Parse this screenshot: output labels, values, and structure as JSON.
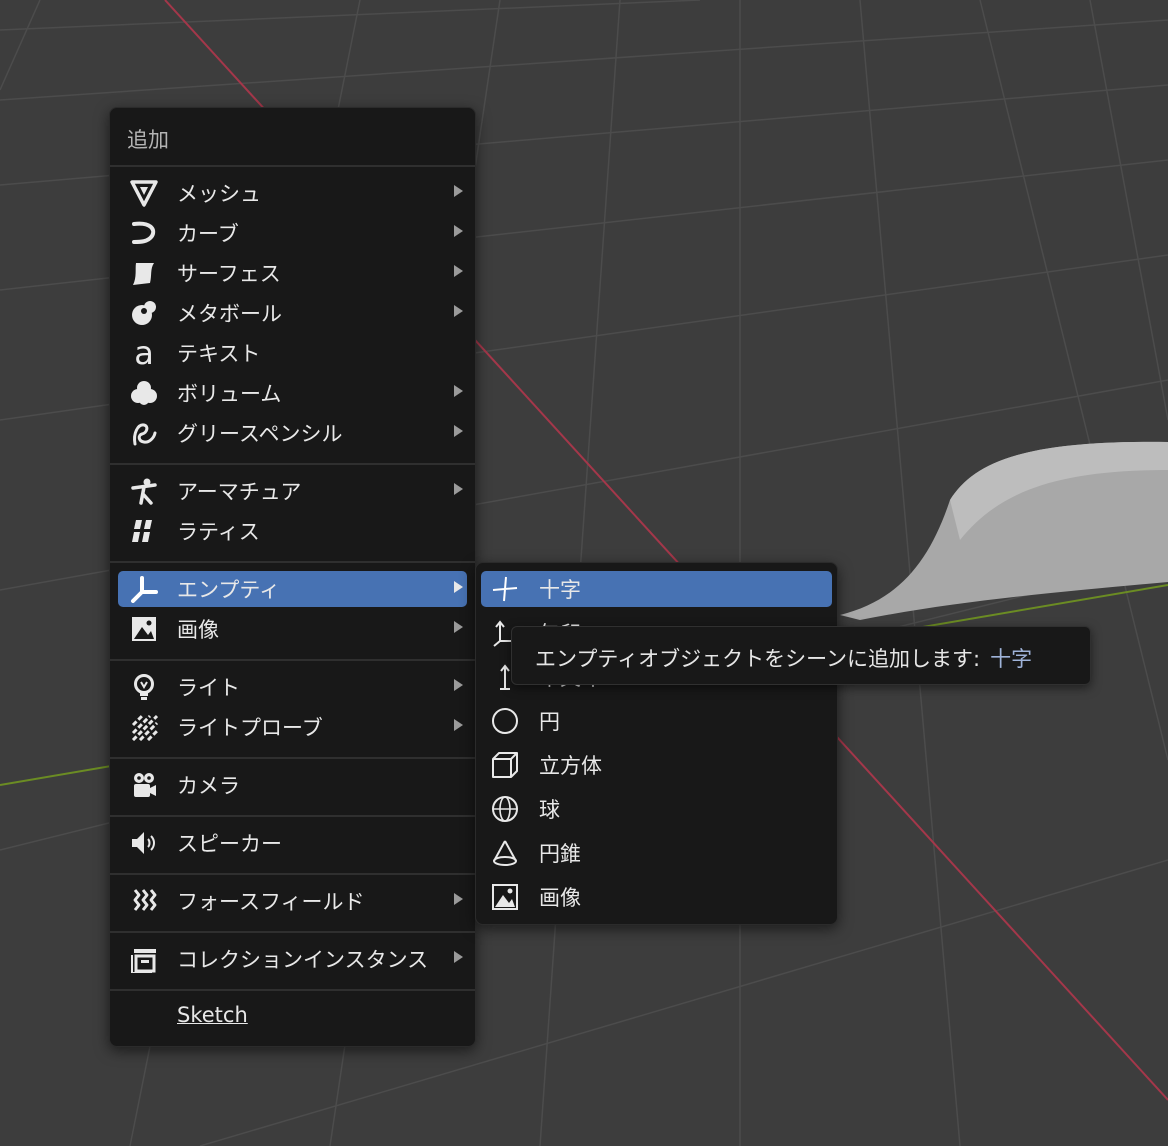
{
  "add_menu": {
    "title": "追加",
    "items": [
      {
        "label": "メッシュ",
        "icon": "mesh-icon",
        "submenu": true
      },
      {
        "label": "カーブ",
        "icon": "curve-icon",
        "submenu": true
      },
      {
        "label": "サーフェス",
        "icon": "surface-icon",
        "submenu": true
      },
      {
        "label": "メタボール",
        "icon": "metaball-icon",
        "submenu": true
      },
      {
        "label": "テキスト",
        "icon": "text-icon",
        "submenu": false
      },
      {
        "label": "ボリューム",
        "icon": "volume-icon",
        "submenu": true
      },
      {
        "label": "グリースペンシル",
        "icon": "grease-pencil-icon",
        "submenu": true
      },
      {
        "label": "アーマチュア",
        "icon": "armature-icon",
        "submenu": true
      },
      {
        "label": "ラティス",
        "icon": "lattice-icon",
        "submenu": false
      },
      {
        "label": "エンプティ",
        "icon": "empty-icon",
        "submenu": true,
        "highlighted": true
      },
      {
        "label": "画像",
        "icon": "image-icon",
        "submenu": true
      },
      {
        "label": "ライト",
        "icon": "light-icon",
        "submenu": true
      },
      {
        "label": "ライトプローブ",
        "icon": "light-probe-icon",
        "submenu": true
      },
      {
        "label": "カメラ",
        "icon": "camera-icon",
        "submenu": false
      },
      {
        "label": "スピーカー",
        "icon": "speaker-icon",
        "submenu": false
      },
      {
        "label": "フォースフィールド",
        "icon": "force-field-icon",
        "submenu": true
      },
      {
        "label": "コレクションインスタンス",
        "icon": "collection-instance-icon",
        "submenu": true
      },
      {
        "label": "Sketch",
        "icon": "",
        "submenu": false
      }
    ]
  },
  "empty_menu": {
    "items": [
      {
        "label": "十字",
        "icon": "plain-axes-icon",
        "highlighted": true
      },
      {
        "label": "矢印",
        "icon": "arrows-icon"
      },
      {
        "label": "単矢印",
        "icon": "single-arrow-icon"
      },
      {
        "label": "円",
        "icon": "circle-icon"
      },
      {
        "label": "立方体",
        "icon": "cube-icon"
      },
      {
        "label": "球",
        "icon": "sphere-icon"
      },
      {
        "label": "円錐",
        "icon": "cone-icon"
      },
      {
        "label": "画像",
        "icon": "image-icon"
      }
    ]
  },
  "tooltip": {
    "text": "エンプティオブジェクトをシーンに追加します:",
    "value": "十字"
  },
  "colors": {
    "viewport_bg": "#3d3d3d",
    "menu_bg": "#181818",
    "highlight": "#4772b3",
    "x_axis": "#a4374a",
    "y_axis": "#6b8c23"
  }
}
